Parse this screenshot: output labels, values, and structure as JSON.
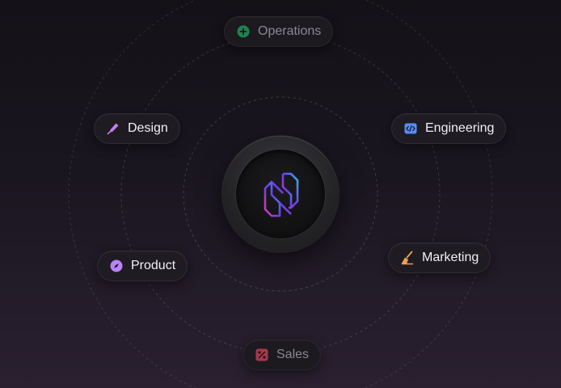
{
  "hub": {
    "logo_icon": "hexagon-n-logo",
    "gradient": [
      "#36b6f0",
      "#6a3cf0",
      "#e23aa8"
    ]
  },
  "teams": [
    {
      "label": "Operations",
      "icon": "plus-circle-icon",
      "color": "#1fa864",
      "dimmed": true
    },
    {
      "label": "Design",
      "icon": "pen-icon",
      "color": "#c77cf0",
      "dimmed": false
    },
    {
      "label": "Engineering",
      "icon": "code-icon",
      "color": "#5a8cf0",
      "dimmed": false
    },
    {
      "label": "Product",
      "icon": "compass-icon",
      "color": "#b983f5",
      "dimmed": false
    },
    {
      "label": "Marketing",
      "icon": "broom-icon",
      "color": "#f0a050",
      "dimmed": false
    },
    {
      "label": "Sales",
      "icon": "percent-icon",
      "color": "#d6425a",
      "dimmed": true
    }
  ]
}
